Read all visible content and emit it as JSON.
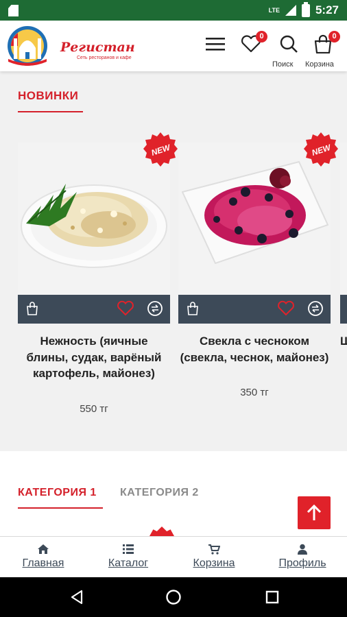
{
  "status_bar": {
    "network": "LTE",
    "time": "5:27"
  },
  "header": {
    "logo_title": "Регистан",
    "logo_subtitle": "Сеть ресторанов и кафе",
    "wishlist_count": "0",
    "search_label": "Поиск",
    "cart_label": "Корзина",
    "cart_count": "0"
  },
  "new_section": {
    "title": "НОВИНКИ",
    "badge_text": "NEW",
    "products": [
      {
        "name": "Нежность (яичные блины, судак, варёный картофель, майонез)",
        "price": "550 тг"
      },
      {
        "name": "Свекла с чесноком (свекла, чеснок, майонез)",
        "price": "350 тг"
      }
    ],
    "next_card_peek": "Ш"
  },
  "categories": {
    "tabs": [
      {
        "label": "КАТЕГОРИЯ 1"
      },
      {
        "label": "КАТЕГОРИЯ 2"
      }
    ]
  },
  "bottom_nav": {
    "items": [
      {
        "label": "Главная",
        "icon": "home-icon"
      },
      {
        "label": "Каталог",
        "icon": "list-icon"
      },
      {
        "label": "Корзина",
        "icon": "cart-icon"
      },
      {
        "label": "Профиль",
        "icon": "user-icon"
      }
    ]
  },
  "colors": {
    "accent": "#e0222a",
    "status_bar": "#1e6b34",
    "card_bar": "#3d4a58"
  }
}
